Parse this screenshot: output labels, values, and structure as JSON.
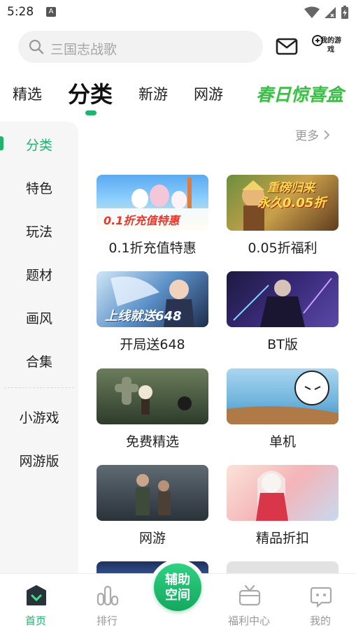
{
  "status_bar": {
    "time": "5:28",
    "notification_badge": "A"
  },
  "search": {
    "placeholder": "三国志战歌"
  },
  "header": {
    "my_games_label": "我的游戏"
  },
  "tabs": [
    {
      "label": "精选"
    },
    {
      "label": "分类",
      "active": true
    },
    {
      "label": "新游"
    },
    {
      "label": "网游"
    }
  ],
  "spring_banner": {
    "text": "春日惊喜盒"
  },
  "sidebar": {
    "items": [
      {
        "label": "分类",
        "active": true
      },
      {
        "label": "特色"
      },
      {
        "label": "玩法"
      },
      {
        "label": "题材"
      },
      {
        "label": "画风"
      },
      {
        "label": "合集"
      },
      {
        "label": "小游戏"
      },
      {
        "label": "网游版"
      }
    ]
  },
  "more": {
    "label": "更多"
  },
  "grid": {
    "cards": [
      {
        "label": "0.1折充值特惠",
        "image_text": "0.1折充值特惠"
      },
      {
        "label": "0.05折福利",
        "image_text_top": "重磅归来",
        "image_text_bottom": "永久0.05折"
      },
      {
        "label": "开局送648",
        "image_text": "上线就送648"
      },
      {
        "label": "BT版"
      },
      {
        "label": "免费精选"
      },
      {
        "label": "单机"
      },
      {
        "label": "网游"
      },
      {
        "label": "精品折扣"
      }
    ]
  },
  "bottom_nav": {
    "items": [
      {
        "label": "首页",
        "icon": "home-icon",
        "active": true
      },
      {
        "label": "排行",
        "icon": "rank-icon"
      },
      {
        "label": "福利中心",
        "icon": "gift-tv-icon"
      },
      {
        "label": "我的",
        "icon": "profile-icon"
      }
    ],
    "center_button": {
      "line1": "辅助",
      "line2": "空间"
    }
  },
  "colors": {
    "accent": "#1cb56b",
    "muted": "#999999",
    "sidebar_bg": "#f6f6f6"
  }
}
